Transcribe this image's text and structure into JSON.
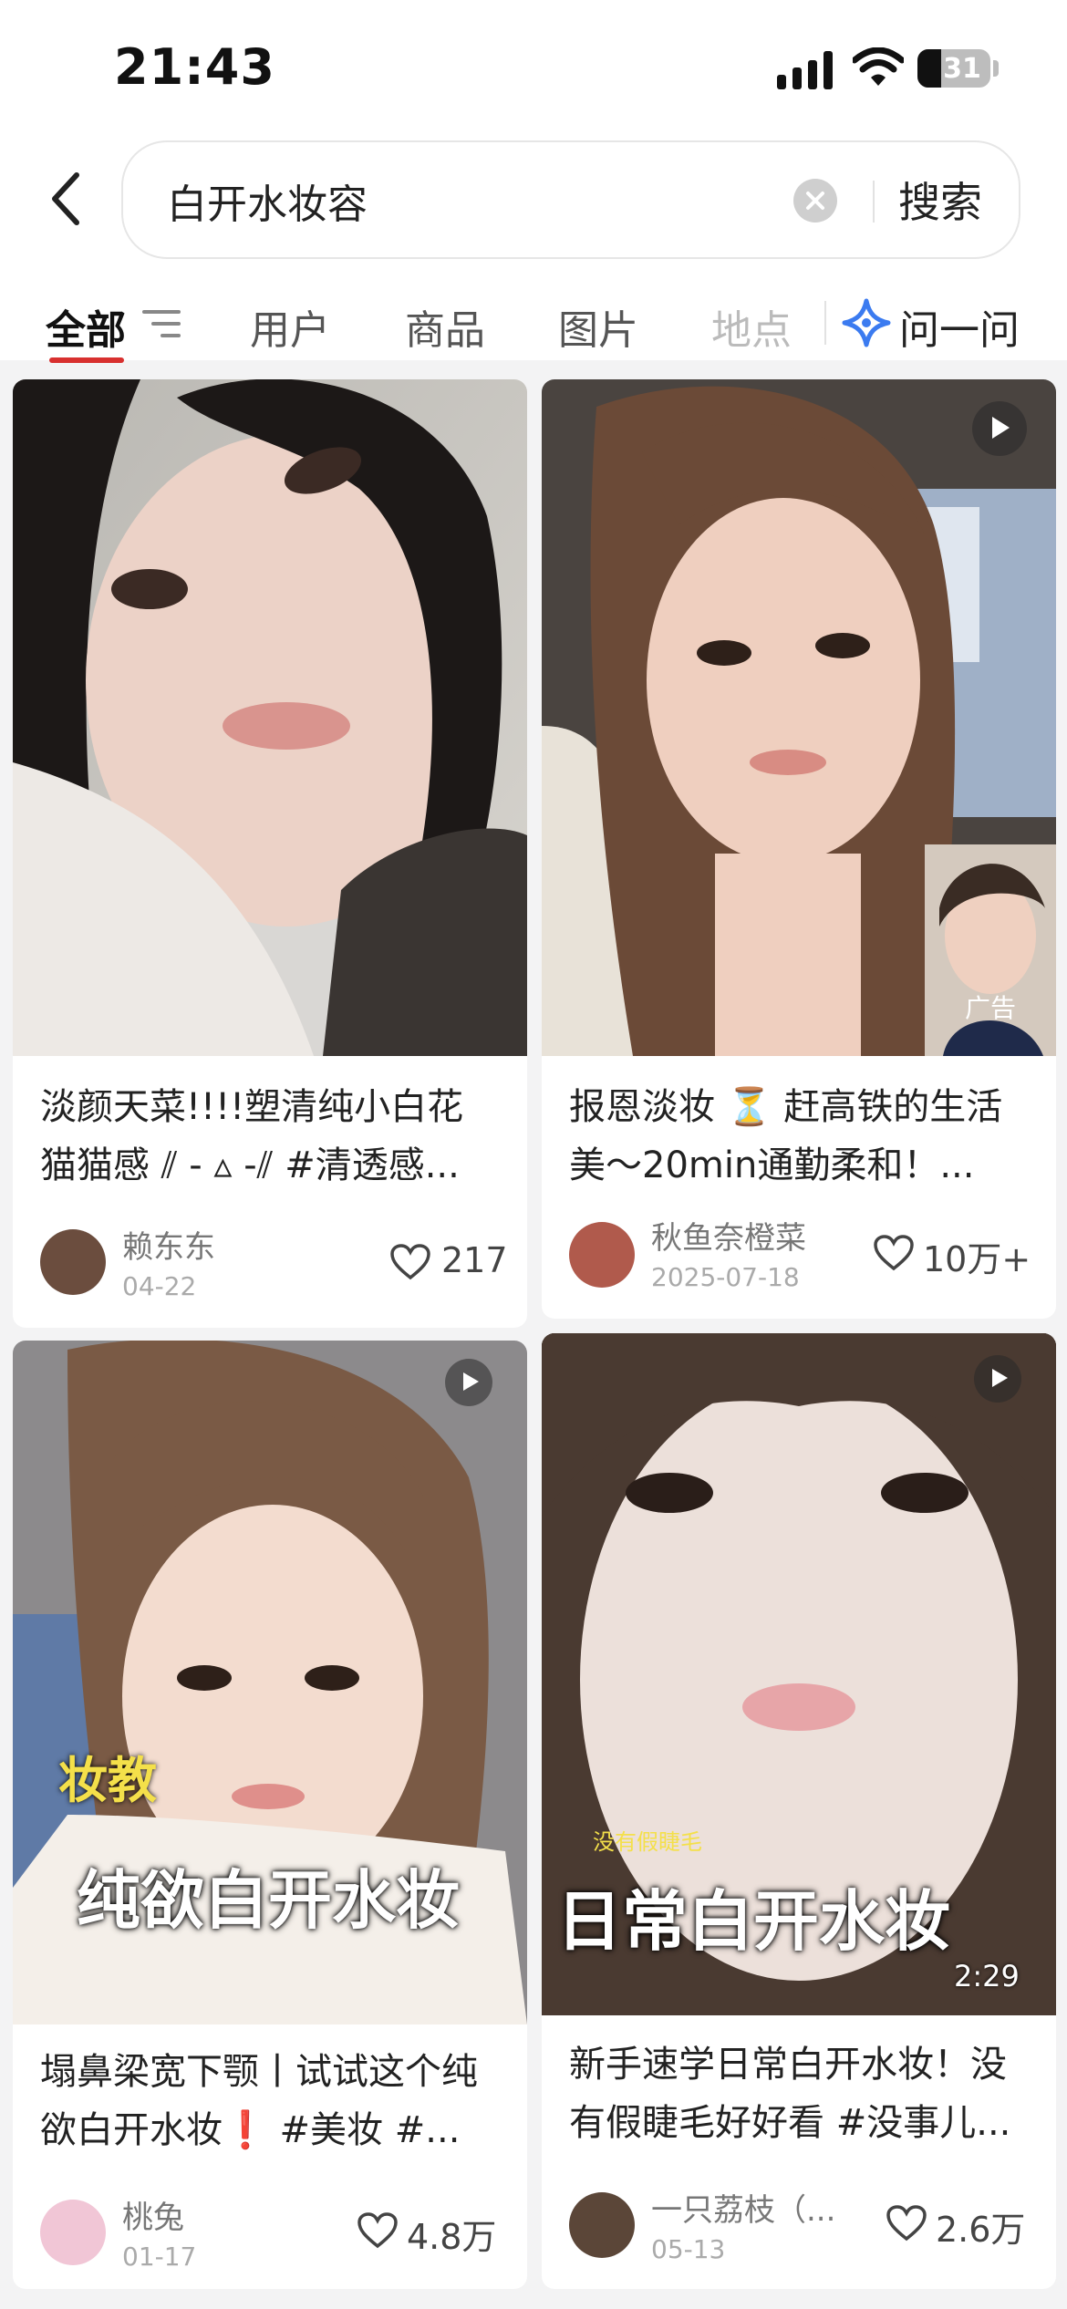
{
  "status_bar": {
    "time": "21:43",
    "battery": "31"
  },
  "search": {
    "query": "白开水妆容",
    "button_label": "搜索"
  },
  "tabs": [
    {
      "label": "全部",
      "active": true
    },
    {
      "label": "用户"
    },
    {
      "label": "商品"
    },
    {
      "label": "图片"
    },
    {
      "label": "地点"
    }
  ],
  "ask": {
    "label": "问一问"
  },
  "cards": [
    {
      "title_line1": "淡颜天菜!!!!塑清纯小白花",
      "title_line2": "猫猫感 ⫽ - ▵ -⫽ #清透感...",
      "author": "赖东东",
      "date": "04-22",
      "likes": "217"
    },
    {
      "title_line1": "报恩淡妆 ⏳ 赶高铁的生活",
      "title_line2": "美～20min通勤柔和！...",
      "author": "秋鱼奈橙菜",
      "date": "2025-07-18",
      "likes": "10万+",
      "ad_label": "广告"
    },
    {
      "title_line1": "塌鼻梁宽下颚丨试试这个纯",
      "title_line2": "欲白开水妆❗ #美妆 #...",
      "author": "桃兔",
      "date": "01-17",
      "likes": "4.8万",
      "overlay_small": "妆教",
      "overlay_big": "纯欲白开水妆"
    },
    {
      "title_line1": "新手速学日常白开水妆！没",
      "title_line2": "有假睫毛好好看 #没事儿...",
      "author": "一只荔枝（...",
      "date": "05-13",
      "likes": "2.6万",
      "overlay_small": "没有假睫毛",
      "overlay_big": "日常白开水妆",
      "duration": "2:29"
    }
  ]
}
